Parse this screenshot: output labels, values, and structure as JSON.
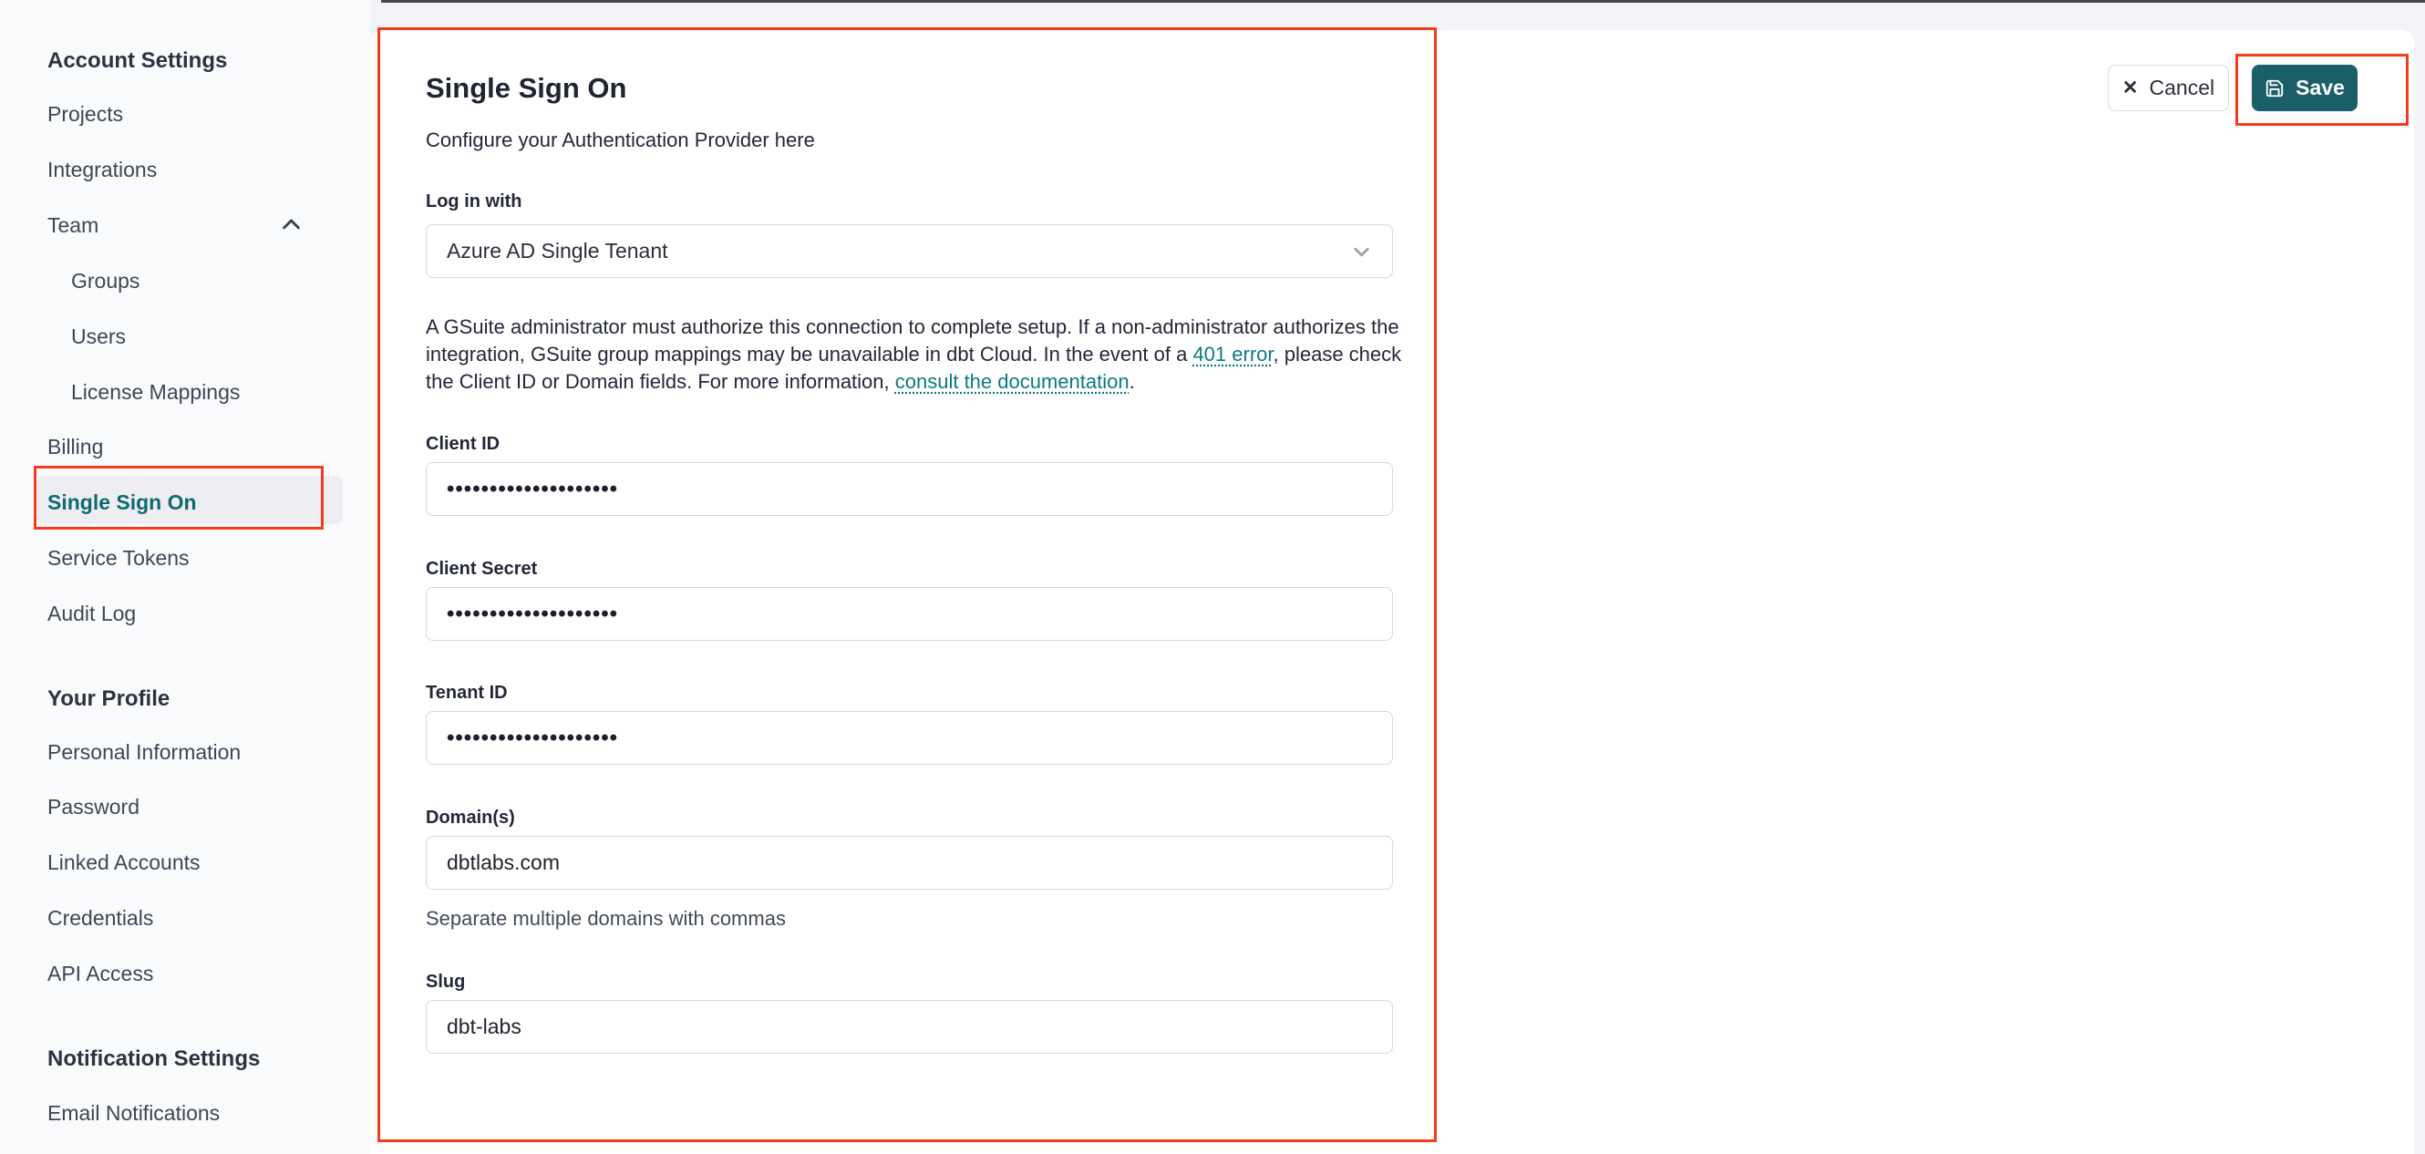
{
  "colors": {
    "accent_teal": "#1a5f68",
    "selected_teal": "#0e6a71",
    "link_teal": "#0d7a80",
    "annotation_red": "#f63b1d"
  },
  "sidebar": {
    "sections": [
      {
        "header": "Account Settings",
        "items": [
          "Projects",
          "Integrations",
          "Team",
          "Groups",
          "Users",
          "License Mappings",
          "Billing",
          "Single Sign On",
          "Service Tokens",
          "Audit Log"
        ]
      },
      {
        "header": "Your Profile",
        "items": [
          "Personal Information",
          "Password",
          "Linked Accounts",
          "Credentials",
          "API Access"
        ]
      },
      {
        "header": "Notification Settings",
        "items": [
          "Email Notifications"
        ]
      }
    ]
  },
  "main": {
    "title": "Single Sign On",
    "subtitle": "Configure your Authentication Provider here",
    "login_label": "Log in with",
    "provider_value": "Azure AD Single Tenant",
    "note": {
      "t1": "A GSuite administrator must authorize this connection to complete setup. If a non-administrator authorizes the integration, GSuite group mappings may be unavailable in dbt Cloud. In the event of a ",
      "link1": "401 error",
      "t2": ", please check the Client ID or Domain fields. For more information, ",
      "link2": "consult the documentation",
      "t3": "."
    },
    "fields": [
      {
        "label": "Client ID",
        "value": "••••••••••••••••••••"
      },
      {
        "label": "Client Secret",
        "value": "••••••••••••••••••••"
      },
      {
        "label": "Tenant ID",
        "value": "••••••••••••••••••••"
      },
      {
        "label": "Domain(s)",
        "value": "dbtlabs.com",
        "helper": "Separate multiple domains with commas"
      },
      {
        "label": "Slug",
        "value": "dbt-labs"
      }
    ],
    "actions": {
      "cancel_label": "Cancel",
      "save_label": "Save"
    }
  }
}
